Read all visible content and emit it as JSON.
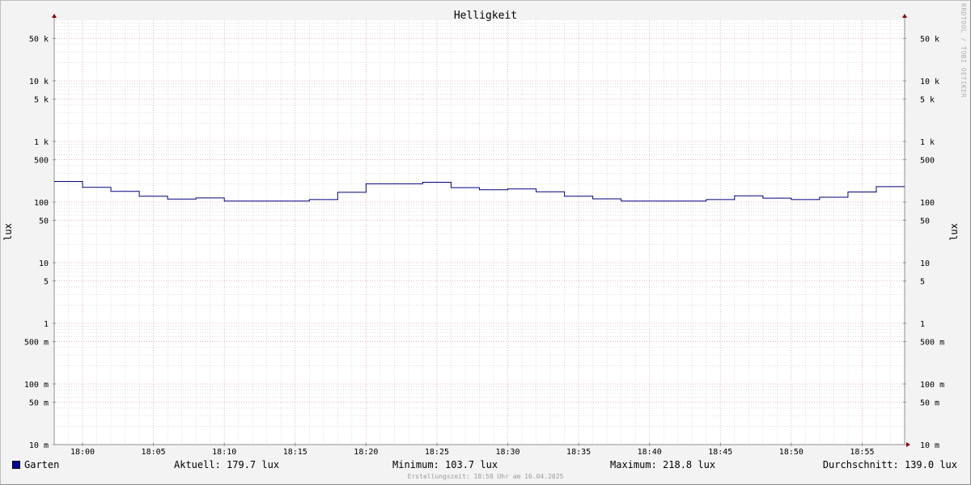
{
  "watermark": "RRDTOOL / TOBI OETIKER",
  "footer": "Erstellungszeit: 18:58 Uhr am 16.04.2025",
  "legend": {
    "series_name": "Garten",
    "current": "Aktuell: 179.7 lux",
    "minimum": "Minimum: 103.7 lux",
    "maximum": "Maximum: 218.8 lux",
    "average": "Durchschnitt: 139.0 lux"
  },
  "colors": {
    "series": "#00007f",
    "swatch": "#0000a0",
    "grid_major": "#e8a0a0",
    "grid_minor": "#c8c8c8",
    "plot_bg": "#ffffff",
    "axis": "#909090",
    "arrow": "#8b0000"
  },
  "chart_data": {
    "type": "line",
    "title": "Helligkeit",
    "ylabel": "lux",
    "ylabel_right": "lux",
    "y_scale": "log",
    "ylim": [
      0.01,
      100000
    ],
    "xlim": [
      "17:58",
      "18:58"
    ],
    "x_ticks": [
      "18:00",
      "18:05",
      "18:10",
      "18:15",
      "18:20",
      "18:25",
      "18:30",
      "18:35",
      "18:40",
      "18:45",
      "18:50",
      "18:55"
    ],
    "y_ticks": [
      {
        "value": 50000,
        "label": "50 k"
      },
      {
        "value": 10000,
        "label": "10 k"
      },
      {
        "value": 5000,
        "label": "5 k"
      },
      {
        "value": 1000,
        "label": "1 k"
      },
      {
        "value": 500,
        "label": "500"
      },
      {
        "value": 100,
        "label": "100"
      },
      {
        "value": 50,
        "label": "50"
      },
      {
        "value": 10,
        "label": "10"
      },
      {
        "value": 5,
        "label": "5"
      },
      {
        "value": 1,
        "label": "1"
      },
      {
        "value": 0.5,
        "label": "500 m"
      },
      {
        "value": 0.1,
        "label": "100 m"
      },
      {
        "value": 0.05,
        "label": "50 m"
      },
      {
        "value": 0.01,
        "label": "10 m"
      }
    ],
    "grid": true,
    "legend_position": "bottom",
    "series": [
      {
        "name": "Garten",
        "step": "post",
        "x": [
          "17:58",
          "18:00",
          "18:02",
          "18:04",
          "18:06",
          "18:08",
          "18:10",
          "18:12",
          "18:14",
          "18:16",
          "18:18",
          "18:20",
          "18:22",
          "18:24",
          "18:26",
          "18:28",
          "18:30",
          "18:32",
          "18:34",
          "18:36",
          "18:38",
          "18:40",
          "18:42",
          "18:44",
          "18:46",
          "18:48",
          "18:50",
          "18:52",
          "18:54",
          "18:56",
          "18:58"
        ],
        "values": [
          218.8,
          175,
          150,
          125,
          112,
          117,
          104,
          104,
          104,
          110,
          145,
          200,
          200,
          212,
          173,
          160,
          165,
          148,
          125,
          113,
          104,
          104,
          104,
          110,
          127,
          116,
          110,
          120,
          147,
          179.7,
          179.7
        ]
      }
    ]
  }
}
